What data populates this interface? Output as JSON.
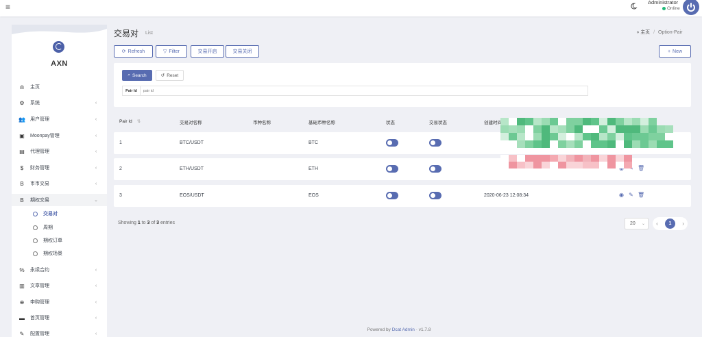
{
  "topbar": {
    "admin_name": "Administrator",
    "admin_status": "Online"
  },
  "brand": {
    "name": "AXN"
  },
  "sidebar": {
    "items": [
      {
        "label": "主页",
        "icon": "bar-chart-icon",
        "glyph": "ılı",
        "chevron": ""
      },
      {
        "label": "系统",
        "icon": "gear-icon",
        "glyph": "⚙",
        "chevron": "‹"
      },
      {
        "label": "用户管理",
        "icon": "users-icon",
        "glyph": "👥",
        "chevron": "‹"
      },
      {
        "label": "Moonpay管理",
        "icon": "card-icon",
        "glyph": "▣",
        "chevron": "‹"
      },
      {
        "label": "代理管理",
        "icon": "id-card-icon",
        "glyph": "▤",
        "chevron": "‹"
      },
      {
        "label": "财务管理",
        "icon": "dollar-icon",
        "glyph": "$",
        "chevron": "‹"
      },
      {
        "label": "币币交易",
        "icon": "bitcoin-icon",
        "glyph": "B",
        "chevron": "‹"
      },
      {
        "label": "期权交易",
        "icon": "bitcoin-icon",
        "glyph": "B",
        "chevron": "⌄"
      }
    ],
    "sub_items": [
      {
        "label": "交易对"
      },
      {
        "label": "周期"
      },
      {
        "label": "期权订单"
      },
      {
        "label": "期权场景"
      }
    ],
    "items_after": [
      {
        "label": "永续合约",
        "icon": "link-icon",
        "glyph": "%",
        "chevron": "‹"
      },
      {
        "label": "文章管理",
        "icon": "article-icon",
        "glyph": "▥",
        "chevron": "‹"
      },
      {
        "label": "申购管理",
        "icon": "crosshair-icon",
        "glyph": "⊕",
        "chevron": "‹"
      },
      {
        "label": "首页管理",
        "icon": "home-block-icon",
        "glyph": "▬",
        "chevron": "‹"
      },
      {
        "label": "配置管理",
        "icon": "wrench-icon",
        "glyph": "✎",
        "chevron": "‹"
      }
    ]
  },
  "header": {
    "title": "交易对",
    "subtitle": "List",
    "breadcrumb_home": "主页",
    "breadcrumb_current": "Option-Pair"
  },
  "toolbar": {
    "refresh": "Refresh",
    "filter": "Filter",
    "open_trade": "交易开启",
    "close_trade": "交易关闭",
    "new": "New"
  },
  "filter": {
    "search": "Search",
    "reset": "Reset",
    "field_label": "Pair Id",
    "field_placeholder": "pair id",
    "field_value": ""
  },
  "table": {
    "columns": [
      "Pair Id",
      "交易对名称",
      "币种名称",
      "基础币种名称",
      "状态",
      "交易状态",
      "创建时间"
    ],
    "rows": [
      {
        "id": "1",
        "pair": "BTC/USDT",
        "coin": "",
        "base": "BTC",
        "status": true,
        "trade_status": true,
        "created": ""
      },
      {
        "id": "2",
        "pair": "ETH/USDT",
        "coin": "",
        "base": "ETH",
        "status": true,
        "trade_status": true,
        "created": ""
      },
      {
        "id": "3",
        "pair": "EOS/USDT",
        "coin": "",
        "base": "EOS",
        "status": true,
        "trade_status": true,
        "created": "2020-06-23 12:08:34"
      }
    ]
  },
  "pagination": {
    "showing_prefix": "Showing",
    "from": "1",
    "to_word": "to",
    "to": "3",
    "of_word": "of",
    "total": "3",
    "entries_word": "entries",
    "per_page": "20",
    "current_page": "1"
  },
  "footer": {
    "prefix": "Powered by",
    "link": "Dcat Admin",
    "version": "v1.7.8"
  },
  "colors": {
    "primary": "#586cb1",
    "online": "#21b978",
    "background": "#eff0f5"
  }
}
